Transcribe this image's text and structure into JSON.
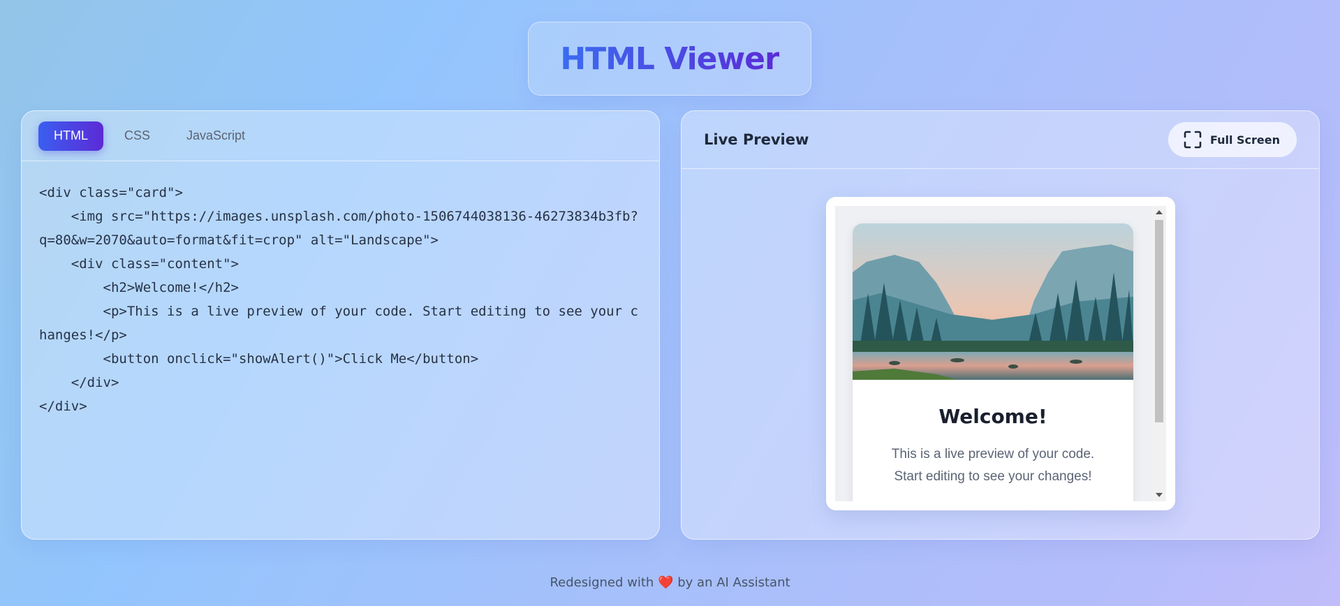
{
  "header": {
    "title": "HTML Viewer"
  },
  "editor": {
    "tabs": [
      {
        "label": "HTML",
        "active": true
      },
      {
        "label": "CSS",
        "active": false
      },
      {
        "label": "JavaScript",
        "active": false
      }
    ],
    "code_lines": [
      "<div class=\"card\">",
      "    <img src=\"https://images.unsplash.com/photo-1506744038136-46273834b3fb?q=80&w=2070&auto=format&fit=crop\" alt=\"Landscape\">",
      "    <div class=\"content\">",
      "        <h2>Welcome!</h2>",
      "        <p>This is a live preview of your code. Start editing to see your changes!</p>",
      "        <button onclick=\"showAlert()\">Click Me</button>",
      "    </div>",
      "</div>"
    ]
  },
  "preview": {
    "title": "Live Preview",
    "fullscreen_label": "Full Screen",
    "fullscreen_icon": "expand-icon",
    "card": {
      "image_alt": "Landscape",
      "heading": "Welcome!",
      "text": "This is a live preview of your code. Start editing to see your changes!"
    }
  },
  "footer": {
    "prefix": "Redesigned with",
    "heart": "❤️",
    "suffix": "by an AI Assistant"
  },
  "colors": {
    "accent_start": "#3b5ef0",
    "accent_end": "#5b2bd6",
    "heart": "#ef4444"
  }
}
